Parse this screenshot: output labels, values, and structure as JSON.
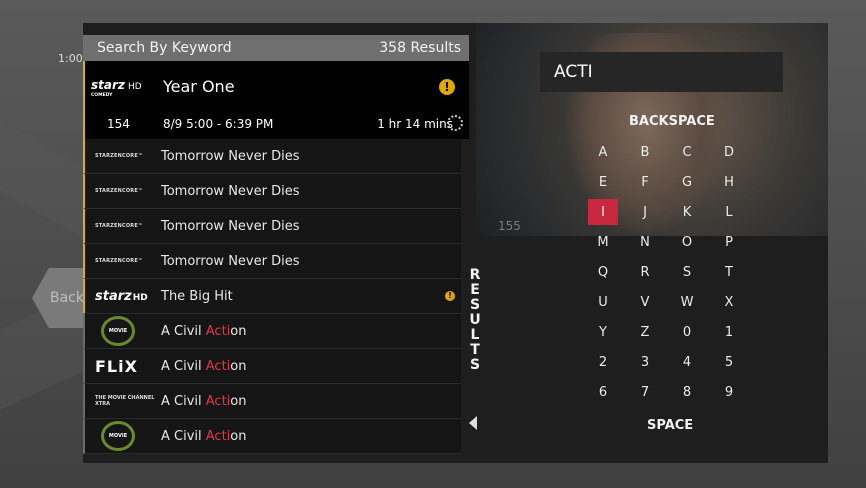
{
  "time_label": "1:00",
  "back_label": "Back",
  "list": {
    "header_title": "Search By Keyword",
    "result_count": "358 Results",
    "selected": {
      "network_logo": "STARZ HD COMEDY",
      "title": "Year One",
      "channel": "154",
      "time": "8/9  5:00 - 6:39 PM",
      "duration": "1 hr 14 mins",
      "warning_icon": "warning-icon"
    },
    "items": [
      {
        "network": "STARZ ENCORE",
        "title": "Tomorrow Never Dies",
        "title_pre": "",
        "title_hl": "",
        "title_post": ""
      },
      {
        "network": "STARZ ENCORE",
        "title": "Tomorrow Never Dies",
        "title_pre": "",
        "title_hl": "",
        "title_post": ""
      },
      {
        "network": "STARZ ENCORE",
        "title": "Tomorrow Never Dies",
        "title_pre": "",
        "title_hl": "",
        "title_post": ""
      },
      {
        "network": "STARZ ENCORE",
        "title": "Tomorrow Never Dies",
        "title_pre": "",
        "title_hl": "",
        "title_post": ""
      },
      {
        "network": "STARZ HD IN BLACK",
        "title": "The Big Hit",
        "title_pre": "",
        "title_hl": "",
        "title_post": ""
      },
      {
        "network": "THE MOVIE CHANNEL",
        "title": "",
        "title_pre": "A Civil ",
        "title_hl": "Acti",
        "title_post": "on"
      },
      {
        "network": "FLIX",
        "title": "",
        "title_pre": "A Civil ",
        "title_hl": "Acti",
        "title_post": "on"
      },
      {
        "network": "THE MOVIE CHANNEL XTRA",
        "title": "",
        "title_pre": "A Civil ",
        "title_hl": "Acti",
        "title_post": "on"
      },
      {
        "network": "THE MOVIE CHANNEL",
        "title": "",
        "title_pre": "A Civil ",
        "title_hl": "Acti",
        "title_post": "on"
      }
    ]
  },
  "results_tab_letters": [
    "R",
    "E",
    "S",
    "U",
    "L",
    "T",
    "S"
  ],
  "video": {
    "channel": "155"
  },
  "search_query": "ACTI",
  "keyboard": {
    "backspace": "BACKSPACE",
    "space": "SPACE",
    "selected_key": "I",
    "rows": [
      [
        "A",
        "B",
        "C",
        "D"
      ],
      [
        "E",
        "F",
        "G",
        "H"
      ],
      [
        "I",
        "J",
        "K",
        "L"
      ],
      [
        "M",
        "N",
        "O",
        "P"
      ],
      [
        "Q",
        "R",
        "S",
        "T"
      ],
      [
        "U",
        "V",
        "W",
        "X"
      ],
      [
        "Y",
        "Z",
        "0",
        "1"
      ],
      [
        "2",
        "3",
        "4",
        "5"
      ],
      [
        "6",
        "7",
        "8",
        "9"
      ]
    ]
  },
  "colors": {
    "accent_selected_key": "#c8283f",
    "highlight_text": "#e8324c",
    "warning": "#e0a800",
    "gold_bar": "#d8b400"
  }
}
